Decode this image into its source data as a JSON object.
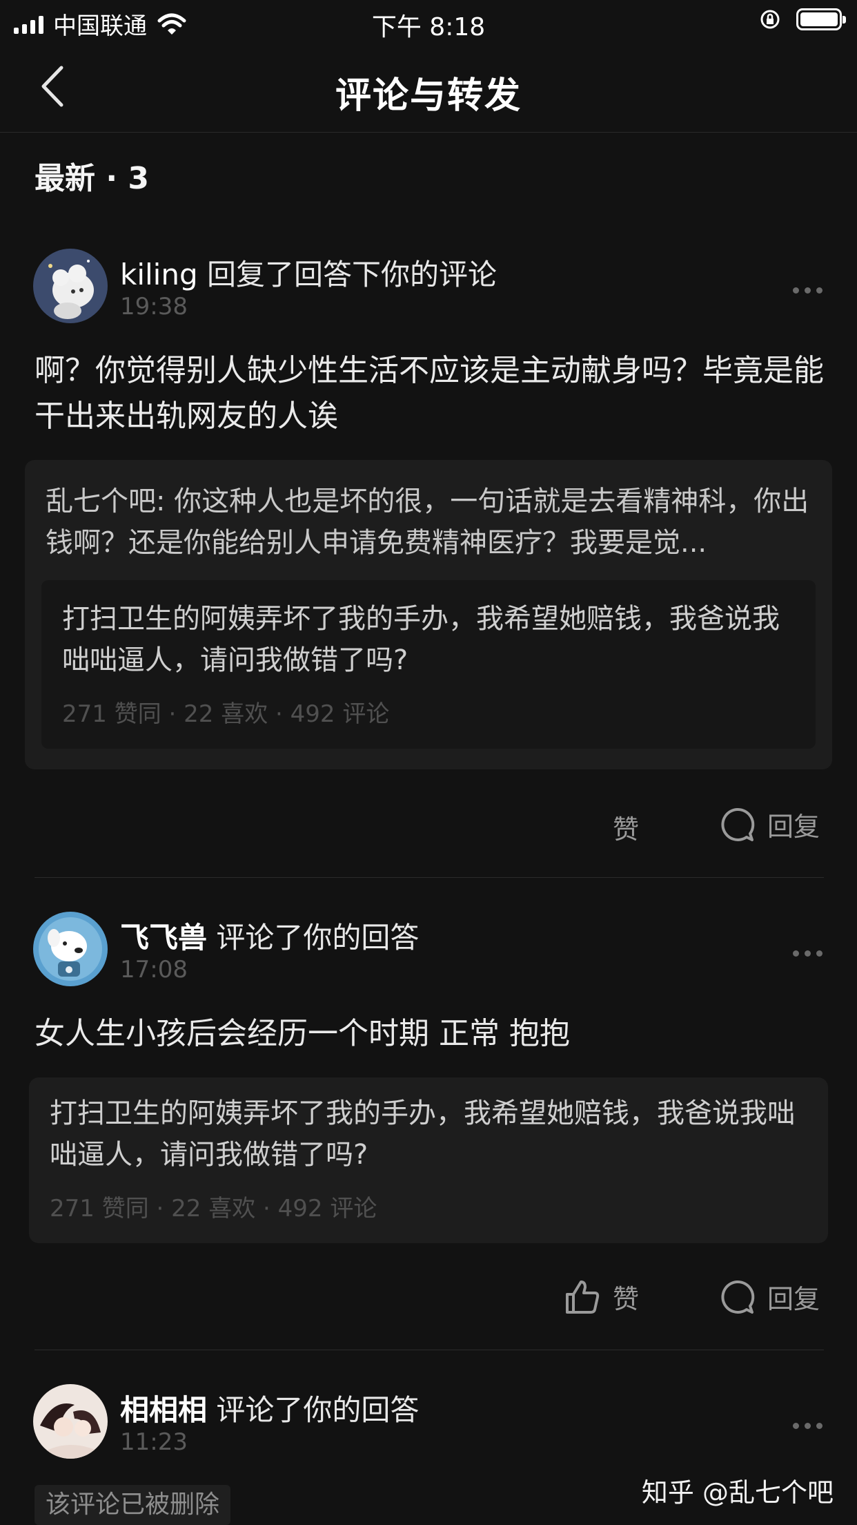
{
  "status_bar": {
    "carrier": "中国联通",
    "time": "下午 8:18"
  },
  "nav": {
    "title": "评论与转发"
  },
  "section": {
    "title": "最新 · 3"
  },
  "comments": [
    {
      "user": "kiling",
      "action": " 回复了回答下你的评论",
      "time": "19:38",
      "text": "啊？你觉得别人缺少性生活不应该是主动献身吗？毕竟是能干出来出轨网友的人诶",
      "quoted_comment": "乱七个吧: 你这种人也是坏的很，一句话就是去看精神科，你出钱啊？还是你能给别人申请免费精神医疗？我要是觉...",
      "question": {
        "title": "打扫卫生的阿姨弄坏了我的手办，我希望她赔钱，我爸说我咄咄逼人，请问我做错了吗?",
        "stats": "271 赞同 · 22 喜欢 · 492 评论"
      },
      "like_label": "赞",
      "reply_label": "回复"
    },
    {
      "user": "飞飞兽",
      "action": " 评论了你的回答",
      "time": "17:08",
      "text": "女人生小孩后会经历一个时期  正常  抱抱",
      "question": {
        "title": "打扫卫生的阿姨弄坏了我的手办，我希望她赔钱，我爸说我咄咄逼人，请问我做错了吗?",
        "stats": "271 赞同 · 22 喜欢 · 492 评论"
      },
      "like_label": "赞",
      "reply_label": "回复"
    },
    {
      "user": "相相相",
      "action": " 评论了你的回答",
      "time": "11:23",
      "deleted_label": "该评论已被删除"
    }
  ],
  "watermark": "知乎 @乱七个吧"
}
